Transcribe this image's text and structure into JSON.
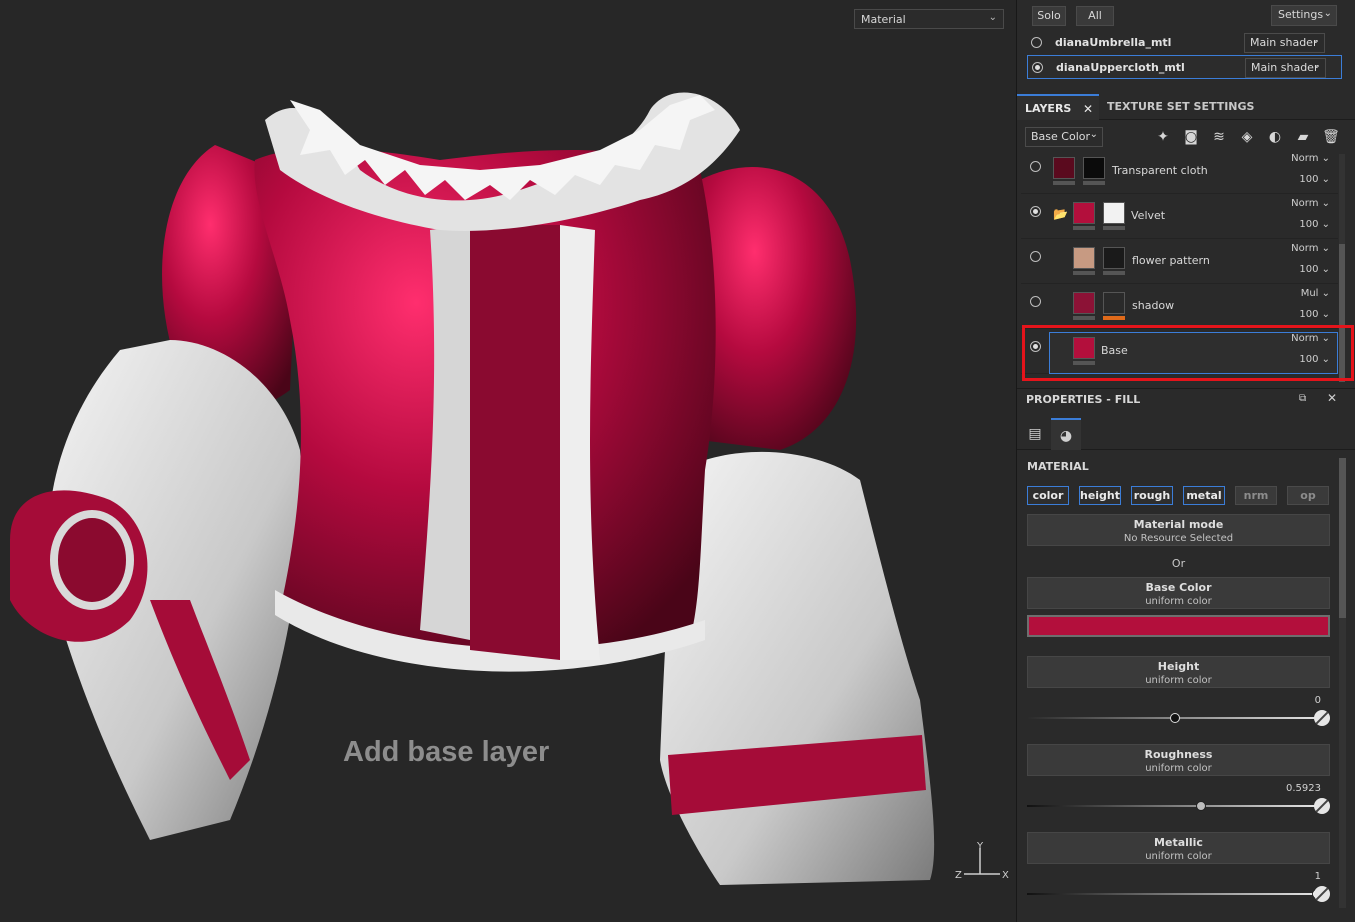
{
  "viewport": {
    "mode_dropdown": "Material",
    "caption": "Add base layer",
    "axis": {
      "y": "Y",
      "z": "Z",
      "x": "X"
    }
  },
  "texture_sets": {
    "solo_label": "Solo",
    "all_label": "All",
    "settings_label": "Settings",
    "rows": [
      {
        "name": "dianaUmbrella_mtl",
        "shader": "Main shader",
        "selected": false
      },
      {
        "name": "dianaUppercloth_mtl",
        "shader": "Main shader",
        "selected": true
      }
    ]
  },
  "tabs": {
    "layers": "LAYERS",
    "texture_set_settings": "TEXTURE SET SETTINGS"
  },
  "layer_toolbar": {
    "channel": "Base Color",
    "icons": [
      "magic-wand-icon",
      "add-mask-icon",
      "add-layer-icon",
      "add-fill-icon",
      "add-effect-icon",
      "add-folder-icon",
      "delete-icon"
    ]
  },
  "layers": [
    {
      "name": "Transparent cloth",
      "blend": "Norm",
      "opacity": "100",
      "visible": false
    },
    {
      "name": "Velvet",
      "blend": "Norm",
      "opacity": "100",
      "visible": true
    },
    {
      "name": "flower pattern",
      "blend": "Norm",
      "opacity": "100",
      "visible": false
    },
    {
      "name": "shadow",
      "blend": "Mul",
      "opacity": "100",
      "visible": false
    },
    {
      "name": "Base",
      "blend": "Norm",
      "opacity": "100",
      "visible": true,
      "selected": true
    }
  ],
  "properties": {
    "title": "PROPERTIES - FILL",
    "material_title": "MATERIAL",
    "channels": [
      {
        "label": "color",
        "enabled": true
      },
      {
        "label": "height",
        "enabled": true
      },
      {
        "label": "rough",
        "enabled": true
      },
      {
        "label": "metal",
        "enabled": true
      },
      {
        "label": "nrm",
        "enabled": false
      },
      {
        "label": "op",
        "enabled": false
      }
    ],
    "material_mode": {
      "title": "Material mode",
      "subtitle": "No Resource Selected"
    },
    "or_label": "Or",
    "base_color": {
      "title": "Base Color",
      "subtitle": "uniform color",
      "value": "#b30f3c"
    },
    "height": {
      "title": "Height",
      "subtitle": "uniform color",
      "value": "0",
      "fraction": 0.5
    },
    "roughness": {
      "title": "Roughness",
      "subtitle": "uniform color",
      "value": "0.5923",
      "fraction": 0.5923
    },
    "metallic": {
      "title": "Metallic",
      "subtitle": "uniform color",
      "value": "1",
      "fraction": 1.0
    }
  },
  "colors": {
    "accent": "#3b7dd8",
    "highlight": "#e5141b",
    "velvet": "#b30f3c"
  }
}
